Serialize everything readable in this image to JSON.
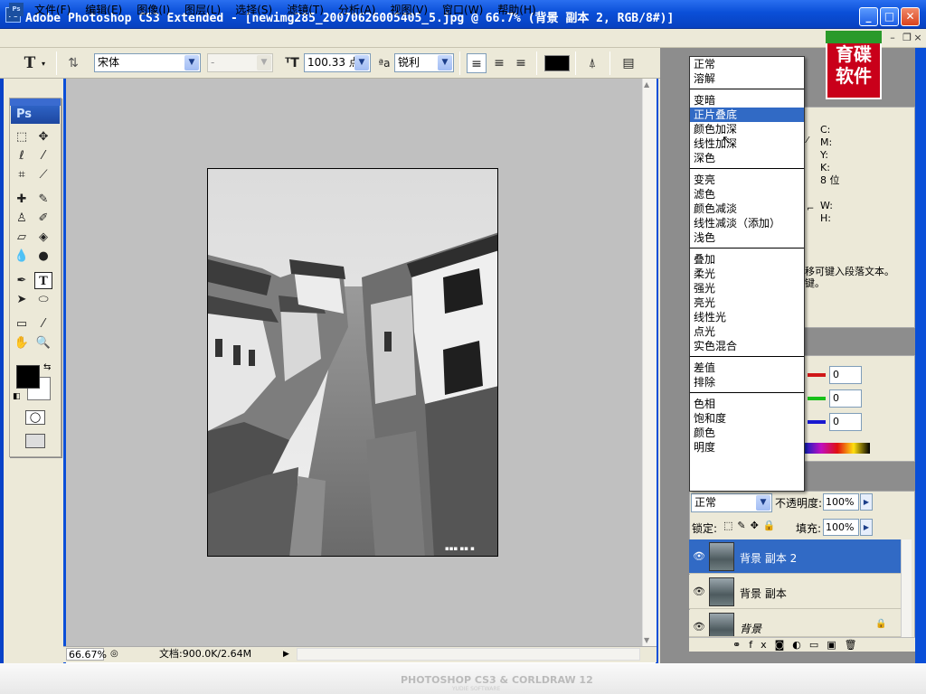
{
  "window": {
    "title": "Adobe Photoshop CS3 Extended - [newimg285_20070626005405_5.jpg @ 66.7% (背景 副本 2, RGB/8#)]",
    "app_icon": "Ps"
  },
  "menubar": {
    "items": [
      "文件(F)",
      "编辑(E)",
      "图像(I)",
      "图层(L)",
      "选择(S)",
      "滤镜(T)",
      "分析(A)",
      "视图(V)",
      "窗口(W)",
      "帮助(H)"
    ]
  },
  "options_bar": {
    "tool_glyph": "T",
    "font_family": "宋体",
    "font_style": "-",
    "font_size": "100.33 点",
    "antialias": "锐利",
    "text_color": "#000000"
  },
  "toolbox": {
    "badge": "Ps"
  },
  "status_bar": {
    "zoom": "66.67%",
    "doc_info": "文档:900.0K/2.64M"
  },
  "blend_modes": {
    "groups": [
      [
        "正常",
        "溶解"
      ],
      [
        "变暗",
        "正片叠底",
        "颜色加深",
        "线性加深",
        "深色"
      ],
      [
        "变亮",
        "滤色",
        "颜色减淡",
        "线性减淡（添加）",
        "浅色"
      ],
      [
        "叠加",
        "柔光",
        "强光",
        "亮光",
        "线性光",
        "点光",
        "实色混合"
      ],
      [
        "差值",
        "排除"
      ],
      [
        "色相",
        "饱和度",
        "颜色",
        "明度"
      ]
    ],
    "selected": "正片叠底"
  },
  "info_panel": {
    "labels": [
      "C:",
      "M:",
      "Y:",
      "K:",
      "8 位"
    ],
    "wh": [
      "W:",
      "H:"
    ],
    "hint_line1": "移可键入段落文本。",
    "hint_line2": "键。"
  },
  "color_panel": {
    "r": "0",
    "g": "0",
    "b": "0"
  },
  "layers_panel": {
    "blend_mode": "正常",
    "opacity_label": "不透明度:",
    "opacity": "100%",
    "lock_label": "锁定:",
    "fill_label": "填充:",
    "fill": "100%",
    "layers": [
      {
        "name": "背景 副本 2",
        "selected": true
      },
      {
        "name": "背景 副本",
        "selected": false
      },
      {
        "name": "背景",
        "selected": false,
        "locked": true
      }
    ]
  },
  "logo": {
    "line1": "育碟",
    "line2": "软件"
  },
  "footer": {
    "text": "PHOTOSHOP CS3 & CORLDRAW 12",
    "sub": "YUDIE SOFTWARE"
  },
  "colors": {
    "selection": "#316ac5",
    "titlebar": "#0a4fd8"
  }
}
